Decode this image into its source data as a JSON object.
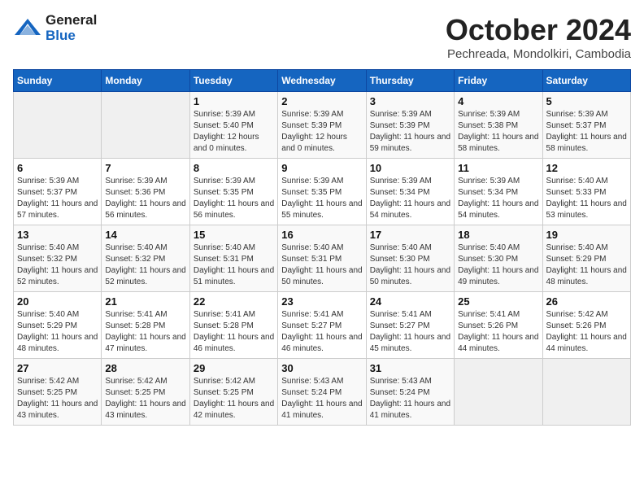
{
  "header": {
    "logo_line1": "General",
    "logo_line2": "Blue",
    "month": "October 2024",
    "location": "Pechreada, Mondolkiri, Cambodia"
  },
  "weekdays": [
    "Sunday",
    "Monday",
    "Tuesday",
    "Wednesday",
    "Thursday",
    "Friday",
    "Saturday"
  ],
  "weeks": [
    [
      {
        "day": "",
        "detail": ""
      },
      {
        "day": "",
        "detail": ""
      },
      {
        "day": "1",
        "detail": "Sunrise: 5:39 AM\nSunset: 5:40 PM\nDaylight: 12 hours and 0 minutes."
      },
      {
        "day": "2",
        "detail": "Sunrise: 5:39 AM\nSunset: 5:39 PM\nDaylight: 12 hours and 0 minutes."
      },
      {
        "day": "3",
        "detail": "Sunrise: 5:39 AM\nSunset: 5:39 PM\nDaylight: 11 hours and 59 minutes."
      },
      {
        "day": "4",
        "detail": "Sunrise: 5:39 AM\nSunset: 5:38 PM\nDaylight: 11 hours and 58 minutes."
      },
      {
        "day": "5",
        "detail": "Sunrise: 5:39 AM\nSunset: 5:37 PM\nDaylight: 11 hours and 58 minutes."
      }
    ],
    [
      {
        "day": "6",
        "detail": "Sunrise: 5:39 AM\nSunset: 5:37 PM\nDaylight: 11 hours and 57 minutes."
      },
      {
        "day": "7",
        "detail": "Sunrise: 5:39 AM\nSunset: 5:36 PM\nDaylight: 11 hours and 56 minutes."
      },
      {
        "day": "8",
        "detail": "Sunrise: 5:39 AM\nSunset: 5:35 PM\nDaylight: 11 hours and 56 minutes."
      },
      {
        "day": "9",
        "detail": "Sunrise: 5:39 AM\nSunset: 5:35 PM\nDaylight: 11 hours and 55 minutes."
      },
      {
        "day": "10",
        "detail": "Sunrise: 5:39 AM\nSunset: 5:34 PM\nDaylight: 11 hours and 54 minutes."
      },
      {
        "day": "11",
        "detail": "Sunrise: 5:39 AM\nSunset: 5:34 PM\nDaylight: 11 hours and 54 minutes."
      },
      {
        "day": "12",
        "detail": "Sunrise: 5:40 AM\nSunset: 5:33 PM\nDaylight: 11 hours and 53 minutes."
      }
    ],
    [
      {
        "day": "13",
        "detail": "Sunrise: 5:40 AM\nSunset: 5:32 PM\nDaylight: 11 hours and 52 minutes."
      },
      {
        "day": "14",
        "detail": "Sunrise: 5:40 AM\nSunset: 5:32 PM\nDaylight: 11 hours and 52 minutes."
      },
      {
        "day": "15",
        "detail": "Sunrise: 5:40 AM\nSunset: 5:31 PM\nDaylight: 11 hours and 51 minutes."
      },
      {
        "day": "16",
        "detail": "Sunrise: 5:40 AM\nSunset: 5:31 PM\nDaylight: 11 hours and 50 minutes."
      },
      {
        "day": "17",
        "detail": "Sunrise: 5:40 AM\nSunset: 5:30 PM\nDaylight: 11 hours and 50 minutes."
      },
      {
        "day": "18",
        "detail": "Sunrise: 5:40 AM\nSunset: 5:30 PM\nDaylight: 11 hours and 49 minutes."
      },
      {
        "day": "19",
        "detail": "Sunrise: 5:40 AM\nSunset: 5:29 PM\nDaylight: 11 hours and 48 minutes."
      }
    ],
    [
      {
        "day": "20",
        "detail": "Sunrise: 5:40 AM\nSunset: 5:29 PM\nDaylight: 11 hours and 48 minutes."
      },
      {
        "day": "21",
        "detail": "Sunrise: 5:41 AM\nSunset: 5:28 PM\nDaylight: 11 hours and 47 minutes."
      },
      {
        "day": "22",
        "detail": "Sunrise: 5:41 AM\nSunset: 5:28 PM\nDaylight: 11 hours and 46 minutes."
      },
      {
        "day": "23",
        "detail": "Sunrise: 5:41 AM\nSunset: 5:27 PM\nDaylight: 11 hours and 46 minutes."
      },
      {
        "day": "24",
        "detail": "Sunrise: 5:41 AM\nSunset: 5:27 PM\nDaylight: 11 hours and 45 minutes."
      },
      {
        "day": "25",
        "detail": "Sunrise: 5:41 AM\nSunset: 5:26 PM\nDaylight: 11 hours and 44 minutes."
      },
      {
        "day": "26",
        "detail": "Sunrise: 5:42 AM\nSunset: 5:26 PM\nDaylight: 11 hours and 44 minutes."
      }
    ],
    [
      {
        "day": "27",
        "detail": "Sunrise: 5:42 AM\nSunset: 5:25 PM\nDaylight: 11 hours and 43 minutes."
      },
      {
        "day": "28",
        "detail": "Sunrise: 5:42 AM\nSunset: 5:25 PM\nDaylight: 11 hours and 43 minutes."
      },
      {
        "day": "29",
        "detail": "Sunrise: 5:42 AM\nSunset: 5:25 PM\nDaylight: 11 hours and 42 minutes."
      },
      {
        "day": "30",
        "detail": "Sunrise: 5:43 AM\nSunset: 5:24 PM\nDaylight: 11 hours and 41 minutes."
      },
      {
        "day": "31",
        "detail": "Sunrise: 5:43 AM\nSunset: 5:24 PM\nDaylight: 11 hours and 41 minutes."
      },
      {
        "day": "",
        "detail": ""
      },
      {
        "day": "",
        "detail": ""
      }
    ]
  ]
}
